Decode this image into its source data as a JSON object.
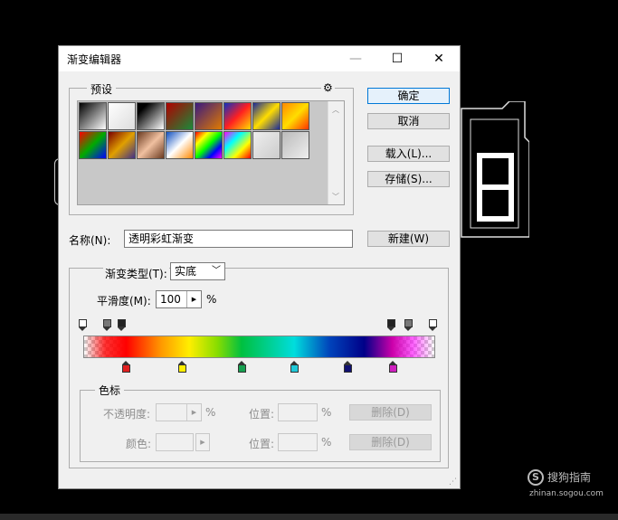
{
  "dialog": {
    "title": "渐变编辑器",
    "window_buttons": {
      "minimize": "—",
      "maximize": "☐",
      "close": "✕"
    }
  },
  "presets": {
    "label": "预设",
    "gear_icon": "⚙",
    "swatches": [
      "linear-gradient(135deg,#000,#fff)",
      "linear-gradient(135deg,#fff,#ddd)",
      "linear-gradient(135deg,#000 20%,#fff)",
      "linear-gradient(135deg,#b00000,#1a8a3a)",
      "linear-gradient(135deg,#3a1a80,#e07a00)",
      "linear-gradient(135deg,#1030c0,#ff2020,#ffdd00)",
      "linear-gradient(135deg,#1a2a9a,#ffdd00,#1a2a9a)",
      "linear-gradient(135deg,#ff8800,#ffdd00,#ff3300)",
      "linear-gradient(135deg,#ff0000,#00aa00,#0000ff)",
      "linear-gradient(135deg,#7a0000,#e0a000,#40308a)",
      "linear-gradient(135deg,#6a3a20,#f0c0a0,#6a3a20)",
      "linear-gradient(135deg,#1050c0,#fff,#ff8800)",
      "linear-gradient(135deg,#ff0000,#ffff00,#00ff00,#0000ff,#ff00ff)",
      "linear-gradient(135deg,#ff00ff,#00ffff,#ffff00,#ff0000)",
      "linear-gradient(135deg,#eee,#ccc)",
      "linear-gradient(135deg,#bbb,#eee)"
    ]
  },
  "buttons": {
    "ok": "确定",
    "cancel": "取消",
    "load": "载入(L)...",
    "save": "存储(S)...",
    "new": "新建(W)"
  },
  "name": {
    "label": "名称(N):",
    "value": "透明彩虹渐变"
  },
  "gradient": {
    "type_label": "渐变类型(T):",
    "type_value": "实底",
    "smoothness_label": "平滑度(M):",
    "smoothness_value": "100",
    "smoothness_unit": "%",
    "opacity_stops": [
      "#ffffff",
      "#777777",
      "#222222",
      "#222222",
      "#777777",
      "#ffffff"
    ],
    "color_stops": [
      "#e02020",
      "#ffee00",
      "#17a050",
      "#20c8d8",
      "#101070",
      "#d020c0"
    ]
  },
  "color_stop_group": {
    "label": "色标",
    "opacity_label": "不透明度:",
    "opacity_unit": "%",
    "location_label": "位置:",
    "location_unit": "%",
    "delete_label": "删除(D)",
    "color_label": "颜色:",
    "location2_label": "位置:",
    "location2_unit": "%",
    "delete2_label": "删除(D)"
  },
  "watermark": {
    "logo": "S",
    "text": "搜狗指南",
    "url": "zhinan.sogou.com"
  }
}
